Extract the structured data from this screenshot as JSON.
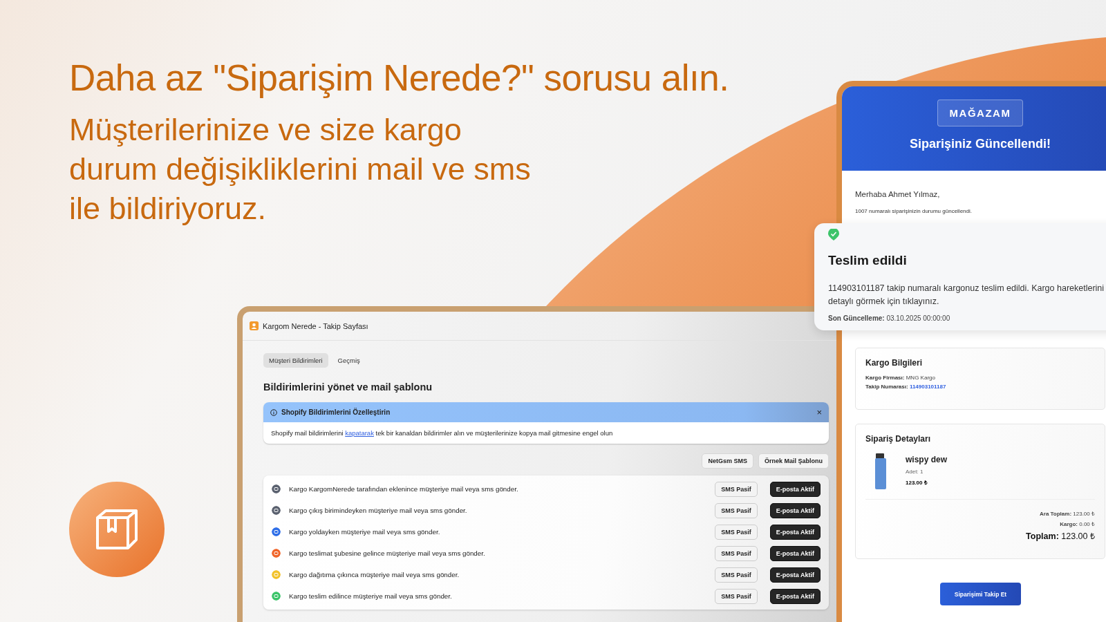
{
  "headline": "Daha az \"Siparişim Nerede?\" sorusu alın.",
  "subtitle_lines": [
    "Müşterilerinize ve size kargo",
    "durum değişikliklerini mail ve sms",
    "ile bildiriyoruz."
  ],
  "app_window": {
    "title": "Kargom Nerede - Takip Sayfası",
    "tabs": [
      {
        "label": "Müşteri Bildirimleri",
        "selected": true
      },
      {
        "label": "Geçmiş",
        "selected": false
      }
    ],
    "heading": "Bildirimlerini yönet ve mail şablonu",
    "banner": {
      "title": "Shopify Bildirimlerini Özelleştirin",
      "close": "×",
      "text_before": "Shopify mail bildirimlerini",
      "link": "kapatarak",
      "text_after": "tek bir kanaldan bildirimler alın ve müşterilerinize kopya mail gitmesine engel olun"
    },
    "toolbar_buttons": [
      "NetGsm SMS",
      "Örnek Mail Şablonu"
    ],
    "notifications": [
      {
        "text": "Kargo KargomNerede tarafından eklenince müşteriye mail veya sms gönder.",
        "color": "#5b6270",
        "sms_label": "SMS Pasif",
        "sms_active": false,
        "email_label": "E-posta Aktif",
        "email_active": true
      },
      {
        "text": "Kargo çıkış birimindeyken müşteriye mail veya sms gönder.",
        "color": "#5b6270",
        "sms_label": "SMS Pasif",
        "sms_active": false,
        "email_label": "E-posta Aktif",
        "email_active": true
      },
      {
        "text": "Kargo yoldayken müşteriye mail veya sms gönder.",
        "color": "#2f6fe8",
        "sms_label": "SMS Pasif",
        "sms_active": false,
        "email_label": "E-posta Aktif",
        "email_active": true
      },
      {
        "text": "Kargo teslimat şubesine gelince müşteriye mail veya sms gönder.",
        "color": "#f0652a",
        "sms_label": "SMS Pasif",
        "sms_active": false,
        "email_label": "E-posta Aktif",
        "email_active": true
      },
      {
        "text": "Kargo dağıtıma çıkınca müşteriye mail veya sms gönder.",
        "color": "#f2c22b",
        "sms_label": "SMS Pasif",
        "sms_active": false,
        "email_label": "E-posta Aktif",
        "email_active": true
      },
      {
        "text": "Kargo teslim edilince müşteriye mail veya sms gönder.",
        "color": "#3cc46a",
        "sms_label": "SMS Pasif",
        "sms_active": false,
        "email_label": "E-posta Aktif",
        "email_active": true
      }
    ]
  },
  "email": {
    "store": "MAĞAZAM",
    "title": "Siparişiniz Güncellendi!",
    "greeting": "Merhaba Ahmet Yılmaz,",
    "intro": "1007 numaralı siparişinizin durumu güncellendi.",
    "shipping": {
      "title": "Kargo Bilgileri",
      "company_label": "Kargo Firması:",
      "company": "MNG Kargo",
      "tracking_label": "Takip Numarası:",
      "tracking": "114903101187"
    },
    "order": {
      "title": "Sipariş Detayları",
      "product": "wispy dew",
      "qty": "Adet: 1",
      "price": "123.00 ₺",
      "subtotal_label": "Ara Toplam:",
      "subtotal": "123.00 ₺",
      "shipping_label": "Kargo:",
      "shipping": "0.00 ₺",
      "total_label": "Toplam:",
      "total": "123.00 ₺"
    },
    "button": "Siparişimi Takip Et"
  },
  "delivery_card": {
    "title": "Teslim edildi",
    "text": "114903101187 takip numaralı kargonuz teslim edildi. Kargo hareketlerini detaylı görmek için tıklayınız.",
    "updated_label": "Son Güncelleme:",
    "updated": "03.10.2025 00:00:00"
  }
}
